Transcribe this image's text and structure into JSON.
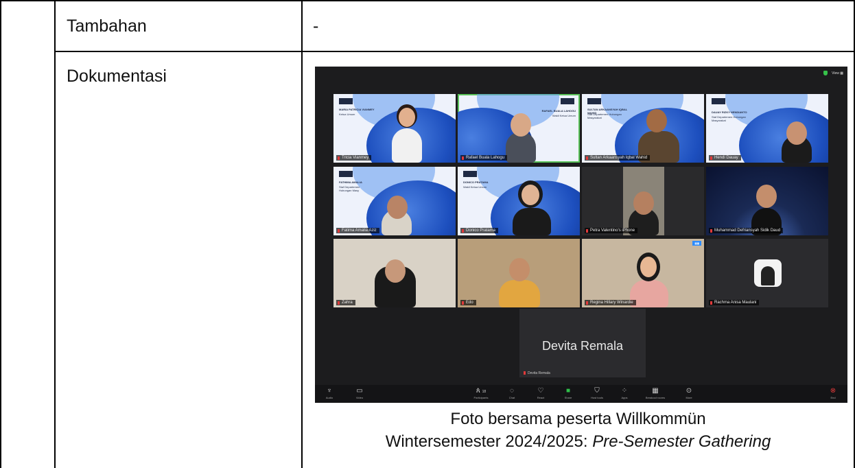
{
  "table": {
    "rows": [
      {
        "label": "Tambahan",
        "value": "-"
      },
      {
        "label": "Dokumentasi"
      }
    ]
  },
  "zoom": {
    "view_label": "View",
    "tiles": [
      {
        "name": "Tricia Vianmey",
        "banner_title": "MARIA PATRICIA VIANMEY",
        "banner_role": "Ketua Umum"
      },
      {
        "name": "Rafael Buala Lahogu",
        "banner_title": "RAFAEL BUALA LAHOGU",
        "banner_role": "Wakil Ketua Umum"
      },
      {
        "name": "Sultan Arkaansyah Iqbal Wahid",
        "banner_title": "SULTAN ARKAANSYAH IQBAL WAHID",
        "banner_role": "Staf Departemen Hubungan Masyarakat"
      },
      {
        "name": "Hendi Dauay",
        "banner_title": "DAUAY RIZKY HENDIANTO",
        "banner_role": "Staf Departemen Hubungan Masyarakat"
      },
      {
        "name": "Fatima Amalia Aziz",
        "banner_title": "FATHIMA AMALIA",
        "banner_role": "Staf Departemen Hubungan Masy"
      },
      {
        "name": "Donico Pratama",
        "banner_title": "DONICO PRATAMA",
        "banner_role": "Wakil Ketua Umum"
      },
      {
        "name": "Petra Valentino's iPhone"
      },
      {
        "name": "Muhammad Defriansyah Sidik Daud"
      },
      {
        "name": "Zahra"
      },
      {
        "name": "Edo"
      },
      {
        "name": "Regina Hillary Winardie"
      },
      {
        "name": "Rachma Anisa Maulani"
      }
    ],
    "big_name": "Devita Remala",
    "small_name": "Devita Remala",
    "toolbar": {
      "audio": "Audio",
      "video": "Video",
      "participants": "Participants",
      "participants_count": "18",
      "chat": "Chat",
      "react": "React",
      "share": "Share",
      "host_tools": "Host tools",
      "apps": "Apps",
      "breakout": "Breakout rooms",
      "more": "More",
      "end": "End"
    }
  },
  "caption": {
    "line1": "Foto bersama peserta Willkommün",
    "line2_plain": "Wintersemester 2024/2025: ",
    "line2_italic": "Pre-Semester Gathering"
  }
}
